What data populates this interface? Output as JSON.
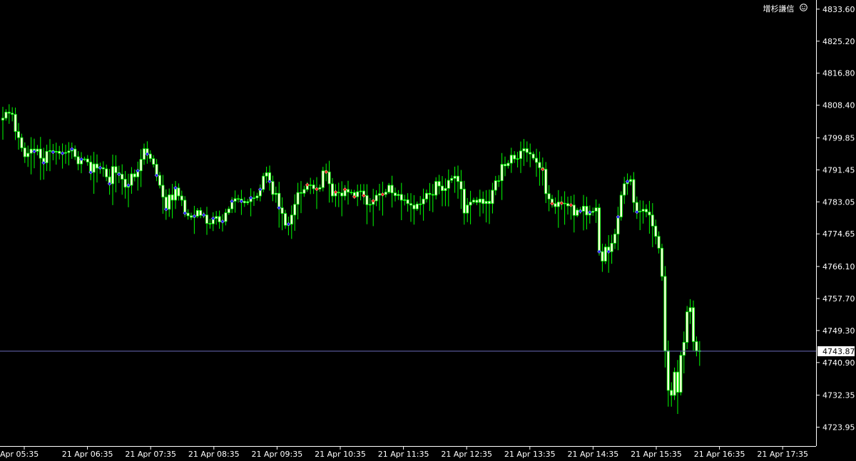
{
  "header": {
    "watermark": "增杉謙信",
    "icon": "smile-icon"
  },
  "colors": {
    "background": "#000000",
    "candle": "#00ff00",
    "body_fill": "#ffffe0",
    "bid_line": "#6b6bbb",
    "marker_blue": "#2222ff",
    "marker_red": "#ff2a1a",
    "axis": "#ffffff",
    "text": "#ffffff"
  },
  "chart_data": {
    "type": "candlestick",
    "title": "",
    "xlabel": "",
    "ylabel": "",
    "ylim": [
      4719.0,
      4836.0
    ],
    "y_ticks": [
      "4833.60",
      "4825.20",
      "4816.80",
      "4808.40",
      "4799.85",
      "4791.45",
      "4783.05",
      "4774.65",
      "4766.10",
      "4757.70",
      "4749.30",
      "4740.90",
      "4732.35",
      "4723.95"
    ],
    "x_ticks": [
      "21 Apr 05:35",
      "21 Apr 06:35",
      "21 Apr 07:35",
      "21 Apr 08:35",
      "21 Apr 09:35",
      "21 Apr 10:35",
      "21 Apr 11:35",
      "21 Apr 12:35",
      "21 Apr 13:35",
      "21 Apr 14:35",
      "21 Apr 15:35",
      "21 Apr 16:35",
      "21 Apr 17:35"
    ],
    "x_ticks_first_display": "Apr 05:35",
    "current_price": "4743.87",
    "current_price_value": 4743.87,
    "grid": false,
    "closes": [
      4804.5,
      4805.0,
      4806.6,
      4806.3,
      4806.0,
      4801.5,
      4799.9,
      4797.2,
      4794.9,
      4795.8,
      4796.9,
      4796.3,
      4796.9,
      4794.5,
      4793.3,
      4796.3,
      4796.5,
      4796.1,
      4796.3,
      4795.8,
      4795.8,
      4796.0,
      4796.4,
      4796.9,
      4794.9,
      4793.0,
      4794.2,
      4794.3,
      4793.5,
      4790.8,
      4793.0,
      4791.9,
      4792.0,
      4791.7,
      4789.6,
      4787.8,
      4792.3,
      4790.7,
      4790.3,
      4789.0,
      4786.9,
      4787.4,
      4790.4,
      4789.6,
      4791.2,
      4794.2,
      4797.0,
      4795.6,
      4794.4,
      4792.9,
      4790.0,
      4787.4,
      4784.3,
      4781.1,
      4784.9,
      4783.5,
      4786.7,
      4784.6,
      4783.5,
      4780.1,
      4779.4,
      4779.0,
      4779.3,
      4780.8,
      4779.5,
      4779.6,
      4777.4,
      4777.3,
      4778.7,
      4779.2,
      4777.8,
      4777.9,
      4780.2,
      4781.2,
      4783.2,
      4783.9,
      4783.8,
      4783.2,
      4782.8,
      4783.1,
      4784.1,
      4784.1,
      4784.6,
      4786.3,
      4789.8,
      4790.7,
      4788.4,
      4785.0,
      4785.3,
      4781.5,
      4780.0,
      4776.9,
      4777.2,
      4779.6,
      4782.4,
      4785.5,
      4785.3,
      4786.3,
      4787.5,
      4787.5,
      4786.5,
      4786.4,
      4786.8,
      4791.2,
      4790.9,
      4787.8,
      4784.6,
      4785.6,
      4785.4,
      4784.6,
      4786.3,
      4785.6,
      4785.5,
      4784.4,
      4785.7,
      4785.9,
      4784.7,
      4782.3,
      4782.4,
      4783.3,
      4784.8,
      4785.2,
      4785.0,
      4785.6,
      4787.4,
      4785.4,
      4784.7,
      4785.0,
      4783.5,
      4783.6,
      4782.6,
      4782.2,
      4781.2,
      4782.5,
      4782.5,
      4783.8,
      4785.3,
      4785.0,
      4784.8,
      4788.4,
      4787.2,
      4786.0,
      4786.6,
      4788.7,
      4789.2,
      4789.8,
      4788.4,
      4786.4,
      4780.1,
      4782.2,
      4783.0,
      4783.5,
      4782.9,
      4783.8,
      4782.6,
      4783.2,
      4782.6,
      4786.1,
      4788.6,
      4788.6,
      4792.9,
      4792.5,
      4793.2,
      4795.3,
      4794.3,
      4794.4,
      4796.4,
      4797.0,
      4796.0,
      4795.6,
      4794.5,
      4793.4,
      4792.0,
      4791.6,
      4785.2,
      4783.8,
      4782.6,
      4781.8,
      4783.0,
      4782.7,
      4782.6,
      4782.0,
      4782.2,
      4779.5,
      4780.9,
      4780.6,
      4781.9,
      4779.6,
      4780.3,
      4780.6,
      4781.5,
      4770.0,
      4767.5,
      4771.2,
      4770.0,
      4772.2,
      4774.6,
      4779.1,
      4784.8,
      4787.8,
      4788.4,
      4788.9,
      4782.9,
      4780.4,
      4780.6,
      4781.1,
      4780.4,
      4779.6,
      4776.7,
      4774.0,
      4770.9,
      4763.5,
      4744.0,
      4733.6,
      4732.3,
      4738.4,
      4733.1,
      4742.8,
      4746.2,
      4754.2,
      4755.3,
      4746.4,
      4744.0,
      4743.9
    ]
  }
}
